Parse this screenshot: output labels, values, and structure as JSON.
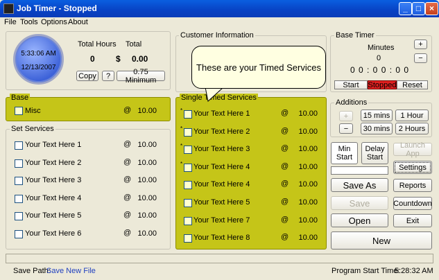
{
  "window": {
    "title": "Job Timer - Stopped"
  },
  "menu": [
    "File",
    "Tools",
    "Options",
    "About"
  ],
  "clock": {
    "time": "5:33:06 AM",
    "date": "12/13/2007"
  },
  "totals": {
    "hours_label": "Total Hours",
    "total_label": "Total",
    "hours_value": "0",
    "currency": "$",
    "total_value": "0.00",
    "copy_label": "Copy",
    "help_label": "?",
    "minimum_label": "0.75 Minimum"
  },
  "customer": {
    "title": "Customer Information"
  },
  "tooltip": {
    "text": "These are your Timed Services"
  },
  "base_timer": {
    "title": "Base Timer",
    "minutes_label": "Minutes",
    "minutes_value": "0",
    "display": "0 0 : 0 0 : 0 0",
    "plus": "+",
    "minus": "−",
    "start": "Start",
    "stopped": "Stopped",
    "reset": "Reset",
    "stopped_color": "#e02020"
  },
  "additions": {
    "title": "Additions",
    "plus": "+",
    "minus": "−",
    "b15": "15 mins",
    "b60": "1 Hour",
    "b30": "30 mins",
    "b120": "2 Hours"
  },
  "base": {
    "title": "Base",
    "item": {
      "label": "Misc",
      "at": "@",
      "value": "10.00"
    }
  },
  "set_services": {
    "title": "Set Services",
    "items": [
      {
        "label": "Your Text Here 1",
        "at": "@",
        "value": "10.00"
      },
      {
        "label": "Your Text Here 2",
        "at": "@",
        "value": "10.00"
      },
      {
        "label": "Your Text Here 3",
        "at": "@",
        "value": "10.00"
      },
      {
        "label": "Your Text Here 4",
        "at": "@",
        "value": "10.00"
      },
      {
        "label": "Your Text Here 5",
        "at": "@",
        "value": "10.00"
      },
      {
        "label": "Your Text Here 6",
        "at": "@",
        "value": "10.00"
      }
    ]
  },
  "single_timed": {
    "title": "Single Timed Services",
    "items": [
      {
        "label": "Your Text Here 1",
        "at": "@",
        "value": "10.00"
      },
      {
        "label": "Your Text Here 2",
        "at": "@",
        "value": "10.00"
      },
      {
        "label": "Your Text Here 3",
        "at": "@",
        "value": "10.00"
      },
      {
        "label": "Your Text Here 4",
        "at": "@",
        "value": "10.00"
      },
      {
        "label": "Your Text Here 4",
        "at": "@",
        "value": "10.00"
      },
      {
        "label": "Your Text Here 5",
        "at": "@",
        "value": "10.00"
      },
      {
        "label": "Your Text Here 7",
        "at": "@",
        "value": "10.00"
      },
      {
        "label": "Your Text Here 8",
        "at": "@",
        "value": "10.00"
      }
    ]
  },
  "controls": {
    "min_start_1": "Min",
    "min_start_2": "Start",
    "delay_start_1": "Delay",
    "delay_start_2": "Start",
    "launch_app": "Launch App",
    "settings": "Settings",
    "save_as": "Save As",
    "reports": "Reports",
    "save": "Save",
    "countdown": "Countdown",
    "open": "Open",
    "exit": "Exit",
    "new": "New"
  },
  "footer": {
    "save_path_label": "Save Path:",
    "save_path_value": "Save New File",
    "program_start_label": "Program Start Time:",
    "program_start_value": "5:28:32 AM"
  }
}
